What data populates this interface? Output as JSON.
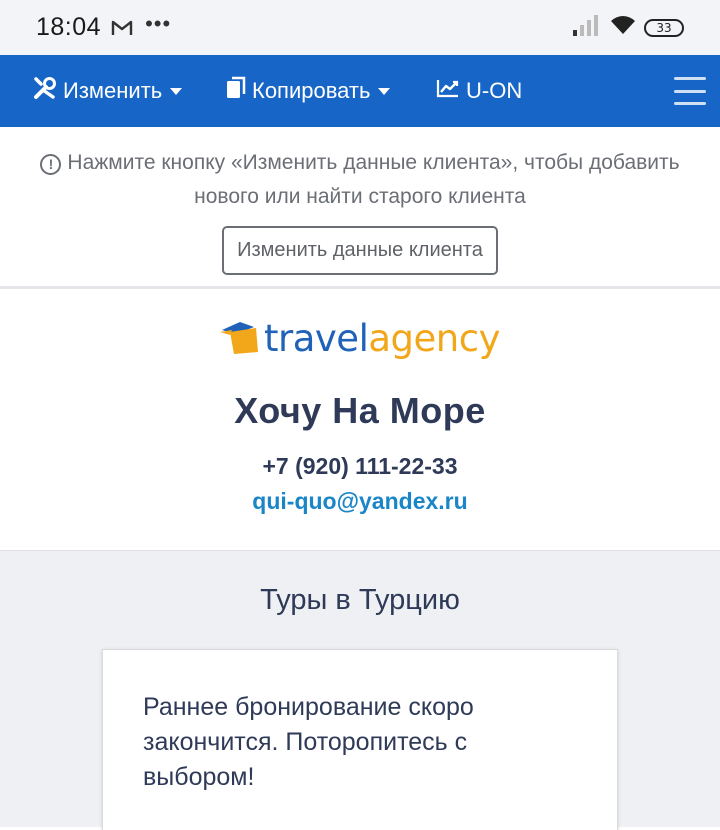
{
  "status_bar": {
    "time": "18:04",
    "battery": "33",
    "icons": [
      "gmail-icon",
      "more-dots-icon",
      "signal-icon",
      "wifi-icon",
      "battery-icon"
    ]
  },
  "toolbar": {
    "edit_label": "Изменить",
    "copy_label": "Копировать",
    "uon_label": "U-ON",
    "icons": [
      "tools-icon",
      "copy-icon",
      "chart-line-icon",
      "hamburger-menu-icon"
    ],
    "background_color": "#1766c7"
  },
  "notice": {
    "text": "Нажмите кнопку «Изменить данные клиента», чтобы добавить нового или найти старого клиента",
    "button_label": "Изменить данные клиента"
  },
  "agency": {
    "logo_part1": "travel",
    "logo_part2": "agency",
    "name": "Хочу На Море",
    "phone": "+7 (920) 111-22-33",
    "email": "qui-quo@yandex.ru",
    "colors": {
      "logo_blue": "#1f62b8",
      "logo_orange": "#f2a71b",
      "email": "#1a86c8"
    }
  },
  "tours": {
    "title": "Туры в Турцию",
    "card_text": "Раннее бронирование скоро закончится. Поторопитесь с выбором!"
  }
}
